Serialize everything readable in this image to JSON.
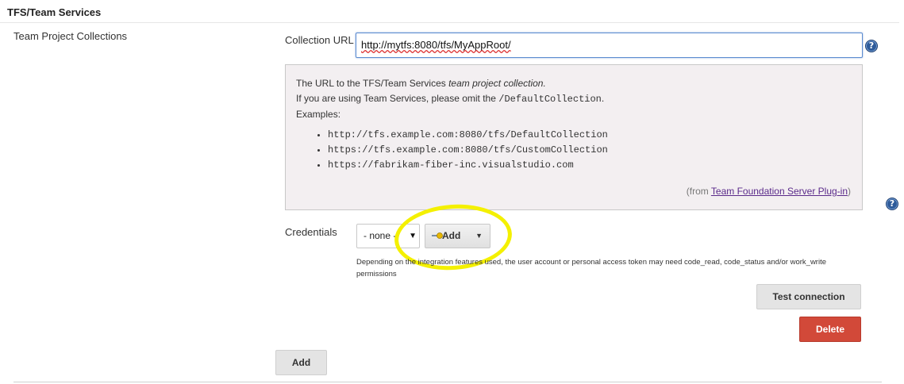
{
  "section": {
    "title": "TFS/Team Services"
  },
  "row": {
    "label": "Team Project Collections"
  },
  "collection_url": {
    "label": "Collection URL",
    "value": "http://mytfs:8080/tfs/MyAppRoot/"
  },
  "help": {
    "line1_prefix": "The URL to the TFS/Team Services ",
    "line1_em": "team project collection.",
    "line2_prefix": "If you are using Team Services, please omit the ",
    "line2_code": "/DefaultCollection",
    "line2_suffix": ".",
    "line3": "Examples:",
    "examples": [
      "http://tfs.example.com:8080/tfs/DefaultCollection",
      "https://tfs.example.com:8080/tfs/CustomCollection",
      "https://fabrikam-fiber-inc.visualstudio.com"
    ],
    "from_prefix": "(from ",
    "from_link": "Team Foundation Server Plug-in",
    "from_suffix": ")"
  },
  "credentials": {
    "label": "Credentials",
    "selected": "- none -",
    "add_label": "Add",
    "hint": "Depending on the integration features used, the user account or personal access token may need code_read, code_status and/or work_write permissions"
  },
  "buttons": {
    "test_connection": "Test connection",
    "delete": "Delete",
    "add": "Add"
  },
  "colors": {
    "delete_bg": "#d24939",
    "highlight": "#f4f000",
    "help_icon": "#2e5b9a",
    "link": "#5a2a8a"
  },
  "icons": [
    "help-icon",
    "key-icon",
    "chevron-down-icon"
  ]
}
